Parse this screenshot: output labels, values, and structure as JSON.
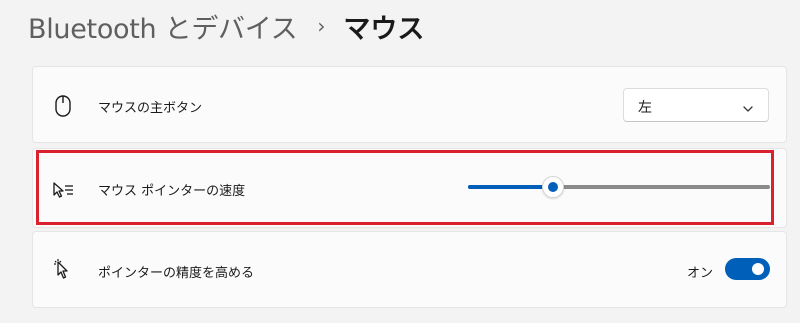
{
  "breadcrumb": {
    "parent": "Bluetooth とデバイス",
    "separator": "›",
    "current": "マウス"
  },
  "settings": [
    {
      "icon": "mouse-icon",
      "label": "マウスの主ボタン",
      "control": "dropdown",
      "selected": "左"
    },
    {
      "icon": "pointer-speed-icon",
      "label": "マウス ポインターの速度",
      "control": "slider",
      "value_fraction": 0.28
    },
    {
      "icon": "pointer-precision-icon",
      "label": "ポインターの精度を高める",
      "control": "toggle",
      "state_label": "オン",
      "on": true
    }
  ],
  "highlight_color": "#d9222e",
  "accent_color": "#005fb8"
}
